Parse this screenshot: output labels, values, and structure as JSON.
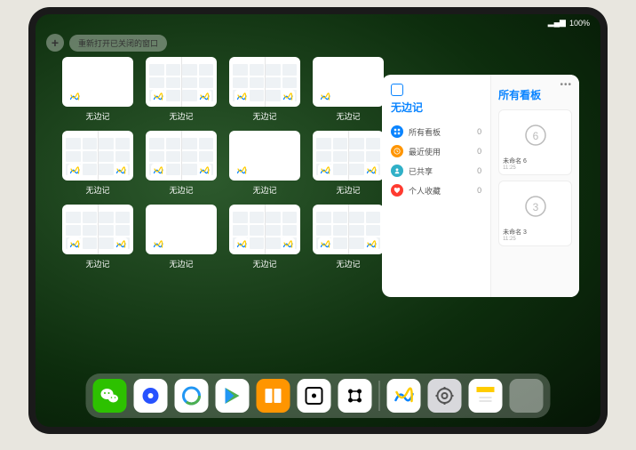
{
  "status": {
    "signal": "▂▄▆",
    "battery": "100%"
  },
  "topbar": {
    "plus": "+",
    "reopen_label": "重新打开已关闭的窗口"
  },
  "tiles": {
    "label": "无边记",
    "items": [
      {
        "split": false
      },
      {
        "split": true
      },
      {
        "split": true
      },
      {
        "split": false
      },
      {
        "split": true
      },
      {
        "split": true
      },
      {
        "split": false
      },
      {
        "split": true
      },
      {
        "split": true
      },
      {
        "split": false
      },
      {
        "split": true
      },
      {
        "split": true
      }
    ]
  },
  "panel": {
    "left_title": "无边记",
    "right_title": "所有看板",
    "categories": [
      {
        "label": "所有看板",
        "count": 0,
        "color": "#0a84ff",
        "icon": "grid"
      },
      {
        "label": "最近使用",
        "count": 0,
        "color": "#ff9500",
        "icon": "clock"
      },
      {
        "label": "已共享",
        "count": 0,
        "color": "#30b0c7",
        "icon": "person"
      },
      {
        "label": "个人收藏",
        "count": 0,
        "color": "#ff3b30",
        "icon": "heart"
      }
    ],
    "boards": [
      {
        "title": "未命名 6",
        "date": "11:25",
        "glyph": "6"
      },
      {
        "title": "未命名 3",
        "date": "11:25",
        "glyph": "3"
      }
    ]
  },
  "dock": {
    "apps": [
      {
        "name": "wechat",
        "bg": "#2dc100"
      },
      {
        "name": "quark",
        "bg": "#ffffff"
      },
      {
        "name": "qqbrowser",
        "bg": "#ffffff"
      },
      {
        "name": "play",
        "bg": "#ffffff"
      },
      {
        "name": "books",
        "bg": "#ff9500"
      },
      {
        "name": "dice",
        "bg": "#ffffff"
      },
      {
        "name": "dots",
        "bg": "#ffffff"
      }
    ],
    "recents": [
      {
        "name": "freeform",
        "bg": "#ffffff"
      },
      {
        "name": "settings",
        "bg": "#d8d8dc"
      },
      {
        "name": "notes",
        "bg": "#ffffff"
      },
      {
        "name": "folder",
        "bg": "group"
      }
    ]
  }
}
